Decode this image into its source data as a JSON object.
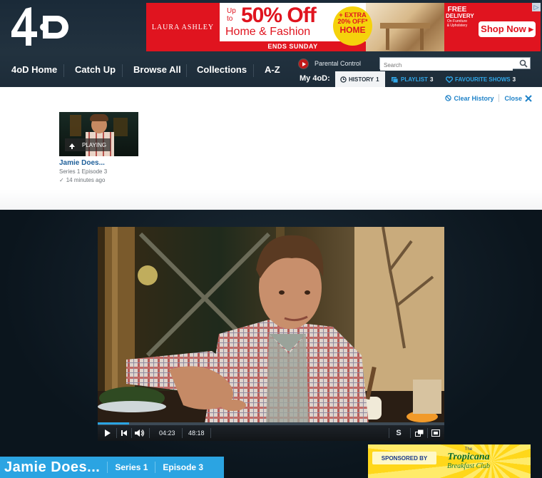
{
  "logo": {
    "text": "4oD"
  },
  "ad": {
    "brand": "LAURA ASHLEY",
    "up_to": "Up to",
    "percent_off": "50% Off",
    "home_fashion": "Home & Fashion",
    "ends": "ENDS SUNDAY",
    "extra_line1": "+ EXTRA",
    "extra_line2": "20% OFF*",
    "extra_line3": "HOME",
    "free_line1": "FREE",
    "free_line2": "DELIVERY",
    "free_line3": "On Furniture & Upholstery",
    "shop_now": "Shop Now ▸",
    "ad_choices_icon": "adchoices-icon"
  },
  "nav": {
    "items": [
      {
        "label": "4oD Home"
      },
      {
        "label": "Catch Up"
      },
      {
        "label": "Browse All"
      },
      {
        "label": "Collections"
      },
      {
        "label": "A-Z"
      }
    ]
  },
  "parental": {
    "label": "Parental Control"
  },
  "search": {
    "placeholder": "Search"
  },
  "my4od": {
    "label": "My 4oD:",
    "tabs": [
      {
        "label": "HISTORY",
        "count": "1",
        "icon": "clock-icon"
      },
      {
        "label": "PLAYLIST",
        "count": "3",
        "icon": "playlist-icon"
      },
      {
        "label": "FAVOURITE SHOWS",
        "count": "3",
        "icon": "heart-icon"
      }
    ]
  },
  "history": {
    "clear_label": "Clear History",
    "close_label": "Close",
    "items": [
      {
        "title": "Jamie Does...",
        "subtitle": "Series 1 Episode 3",
        "ago": "14 minutes ago",
        "status": "PLAYING"
      }
    ]
  },
  "player": {
    "current_time": "04:23",
    "duration": "48:18",
    "progress": 0.09,
    "subtitles_label": "S"
  },
  "episode": {
    "title": "Jamie Does...",
    "series": "Series 1",
    "episode": "Episode 3"
  },
  "sponsor": {
    "label": "SPONSORED BY",
    "brand_the": "The",
    "brand_name": "Tropicana",
    "brand_sub": "Breakfast Club"
  },
  "colors": {
    "accent_blue": "#2ba4e2",
    "link_blue": "#1f82c8",
    "header_bg": "#1e2e3b",
    "ad_red": "#e0141f"
  }
}
